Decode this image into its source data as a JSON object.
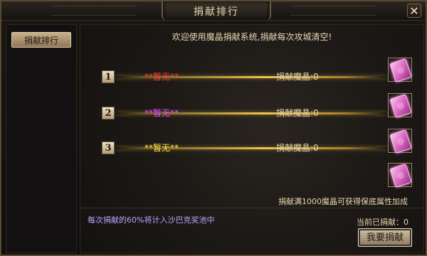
{
  "window": {
    "title": "捐献排行",
    "close_label": "✕"
  },
  "sidebar": {
    "tabs": [
      {
        "label": "捐献排行",
        "active": true
      }
    ]
  },
  "main": {
    "welcome_text": "欢迎使用魔晶捐献系统,捐献每次攻城清空!",
    "ranks": [
      {
        "rank": "1",
        "name": "**暂无**",
        "name_color": "#ff3b3b",
        "amount_text": "捐献魔晶:0"
      },
      {
        "rank": "2",
        "name": "**暂无**",
        "name_color": "#e34cff",
        "amount_text": "捐献魔晶:0"
      },
      {
        "rank": "3",
        "name": "**暂无**",
        "name_color": "#ffe34d",
        "amount_text": "捐献魔晶:0"
      }
    ],
    "reward_items": [
      {
        "icon": "crystal-icon"
      },
      {
        "icon": "crystal-icon"
      },
      {
        "icon": "crystal-icon"
      },
      {
        "icon": "crystal-icon"
      }
    ],
    "bonus_hint": "捐献满1000魔晶可获得保底属性加成",
    "pool_note": "每次捐献的60%将计入沙巴克奖池中",
    "current_donation": "当前已捐献：0",
    "donate_button": "我要捐献"
  }
}
